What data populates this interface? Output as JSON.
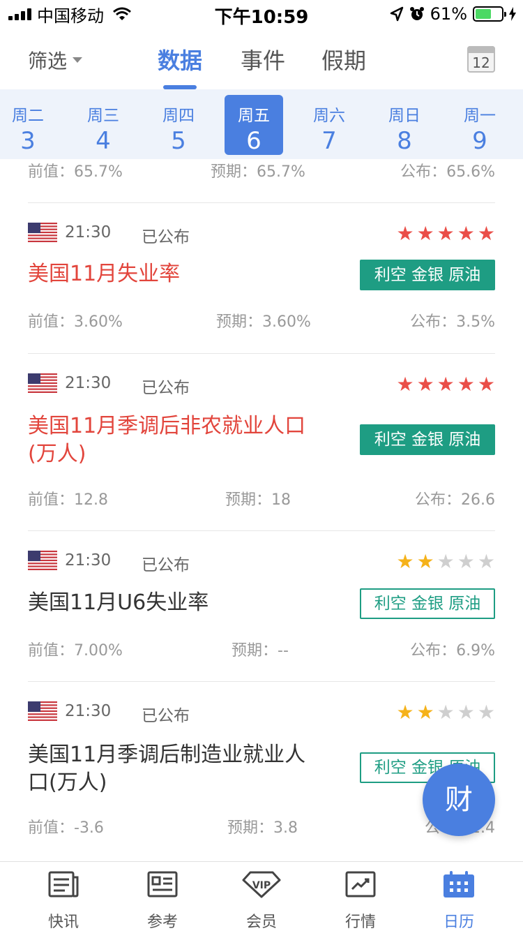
{
  "status_bar": {
    "carrier": "中国移动",
    "time": "下午10:59",
    "battery_text": "61%",
    "battery_level": 0.61
  },
  "nav": {
    "filter_label": "筛选",
    "tabs": [
      {
        "label": "数据",
        "active": true
      },
      {
        "label": "事件",
        "active": false
      },
      {
        "label": "假期",
        "active": false
      }
    ],
    "calendar_day": "12"
  },
  "days": [
    {
      "weekday": "周二",
      "date": "3"
    },
    {
      "weekday": "周三",
      "date": "4"
    },
    {
      "weekday": "周四",
      "date": "5"
    },
    {
      "weekday": "周五",
      "date": "6",
      "active": true
    },
    {
      "weekday": "周六",
      "date": "7"
    },
    {
      "weekday": "周日",
      "date": "8"
    },
    {
      "weekday": "周一",
      "date": "9"
    }
  ],
  "top_partial": {
    "previous": "前值：65.7%",
    "forecast": "预期：65.7%",
    "actual": "公布：65.6%"
  },
  "events": [
    {
      "time": "21:30",
      "status": "已公布",
      "stars": 5,
      "star_color": "red",
      "title": "美国11月失业率",
      "title_color": "red",
      "tag": "利空 金银 原油",
      "tag_style": "filled",
      "previous": "前值：3.60%",
      "forecast": "预期：3.60%",
      "actual": "公布：3.5%"
    },
    {
      "time": "21:30",
      "status": "已公布",
      "stars": 5,
      "star_color": "red",
      "title": "美国11月季调后非农就业人口(万人)",
      "title_color": "red",
      "tag": "利空 金银 原油",
      "tag_style": "filled",
      "previous": "前值：12.8",
      "forecast": "预期：18",
      "actual": "公布：26.6"
    },
    {
      "time": "21:30",
      "status": "已公布",
      "stars": 2,
      "star_color": "gold",
      "title": "美国11月U6失业率",
      "title_color": "dark",
      "tag": "利空 金银 原油",
      "tag_style": "outline",
      "previous": "前值：7.00%",
      "forecast": "预期：--",
      "actual": "公布：6.9%"
    },
    {
      "time": "21:30",
      "status": "已公布",
      "stars": 2,
      "star_color": "gold",
      "title": "美国11月季调后制造业就业人口(万人)",
      "title_color": "dark",
      "tag": "利空 金银 原油",
      "tag_style": "outline",
      "previous": "前值：-3.6",
      "forecast": "预期：3.8",
      "actual": "公布：2.4"
    }
  ],
  "fab_label": "财",
  "bottom_nav": [
    {
      "label": "快讯",
      "icon": "news-icon"
    },
    {
      "label": "参考",
      "icon": "reference-icon"
    },
    {
      "label": "会员",
      "icon": "vip-icon"
    },
    {
      "label": "行情",
      "icon": "chart-icon"
    },
    {
      "label": "日历",
      "icon": "calendar-icon",
      "active": true
    }
  ],
  "colors": {
    "accent": "#4a7fe0",
    "bearish_tag": "#1e9d83",
    "title_red": "#e2453c",
    "star_red": "#ea4e48",
    "star_gold": "#f5b21a"
  }
}
